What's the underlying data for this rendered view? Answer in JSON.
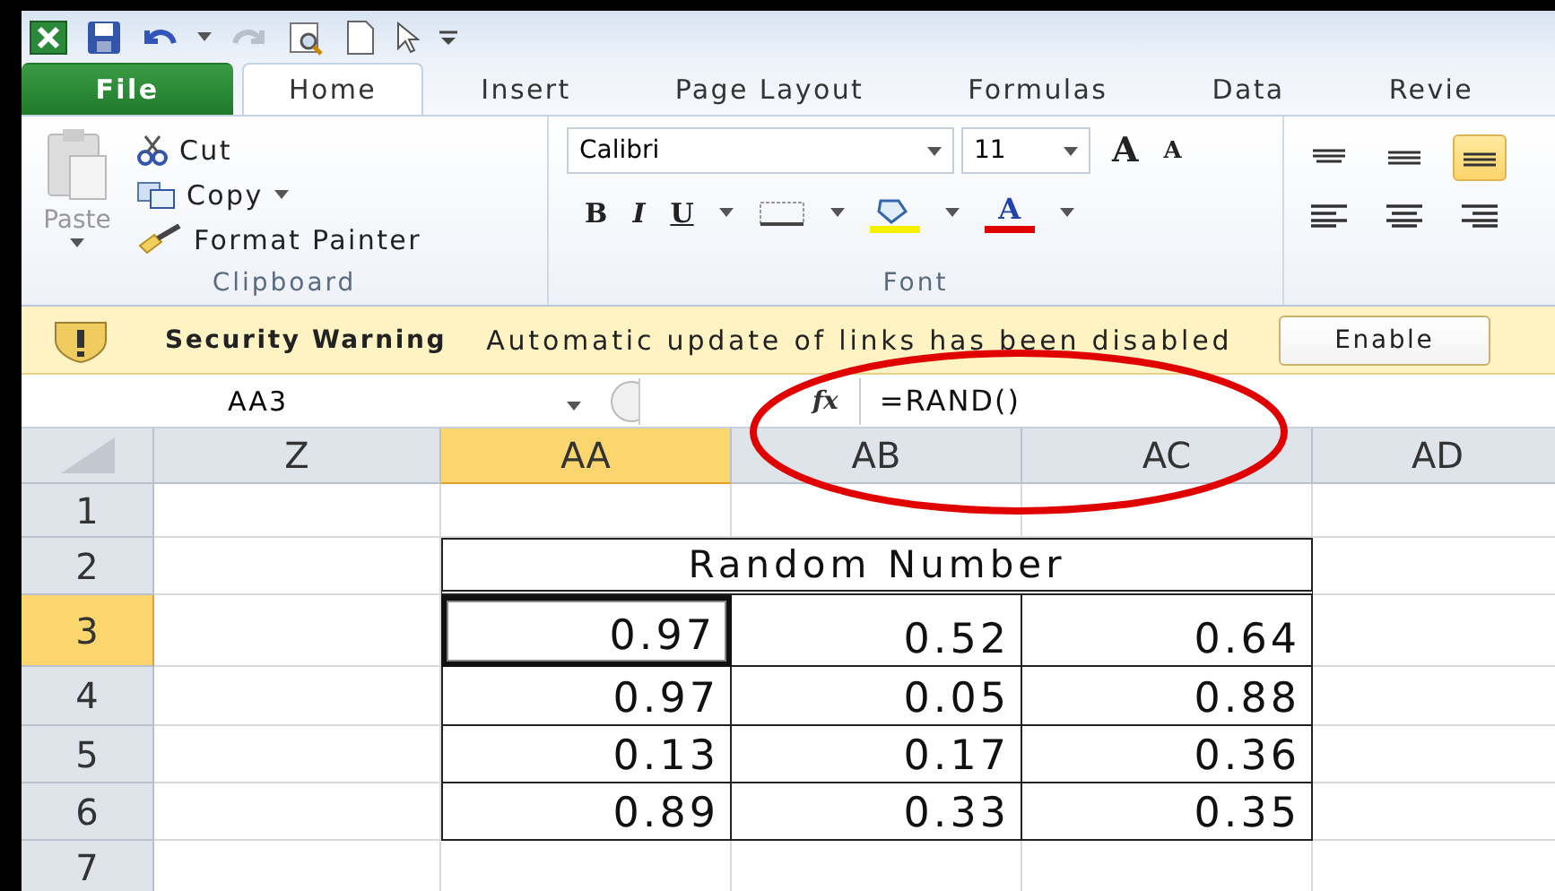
{
  "tabs": [
    {
      "label": "File",
      "kind": "file",
      "selected": false
    },
    {
      "label": "Home",
      "kind": "tab",
      "selected": true
    },
    {
      "label": "Insert",
      "kind": "tab",
      "selected": false
    },
    {
      "label": "Page Layout",
      "kind": "tab",
      "selected": false
    },
    {
      "label": "Formulas",
      "kind": "tab",
      "selected": false
    },
    {
      "label": "Data",
      "kind": "tab",
      "selected": false
    },
    {
      "label": "Revie",
      "kind": "tab",
      "selected": false
    }
  ],
  "clipboard": {
    "paste": "Paste",
    "cut": "Cut",
    "copy": "Copy",
    "format_painter": "Format Painter",
    "group_label": "Clipboard"
  },
  "font": {
    "font_name": "Calibri",
    "font_size": "11",
    "grow": "A",
    "shrink": "A",
    "bold": "B",
    "italic": "I",
    "underline": "U",
    "font_color": "A",
    "group_label": "Font"
  },
  "alignment": [
    {
      "selected": false
    },
    {
      "selected": false
    },
    {
      "selected": true
    }
  ],
  "security_bar": {
    "title": "Security Warning",
    "message": "Automatic update of links has been disabled",
    "button": "Enable"
  },
  "formula_bar": {
    "name_box": "AA3",
    "function_symbol": "fx",
    "formula": "=RAND()"
  },
  "columns": [
    {
      "label": "Z",
      "selected": false
    },
    {
      "label": "AA",
      "selected": true
    },
    {
      "label": "AB",
      "selected": false
    },
    {
      "label": "AC",
      "selected": false
    },
    {
      "label": "AD",
      "selected": false
    }
  ],
  "rows": [
    {
      "label": "1",
      "selected": false
    },
    {
      "label": "2",
      "selected": false,
      "title": "Random Number"
    },
    {
      "label": "3",
      "selected": true,
      "cells": [
        {
          "value": "0.97",
          "active": true
        },
        {
          "value": "0.52",
          "active": false
        },
        {
          "value": "0.64",
          "active": false
        }
      ]
    },
    {
      "label": "4",
      "selected": false,
      "cells": [
        {
          "value": "0.97",
          "active": false
        },
        {
          "value": "0.05",
          "active": false
        },
        {
          "value": "0.88",
          "active": false
        }
      ]
    },
    {
      "label": "5",
      "selected": false,
      "cells": [
        {
          "value": "0.13",
          "active": false
        },
        {
          "value": "0.17",
          "active": false
        },
        {
          "value": "0.36",
          "active": false
        }
      ]
    },
    {
      "label": "6",
      "selected": false,
      "cells": [
        {
          "value": "0.89",
          "active": false
        },
        {
          "value": "0.33",
          "active": false
        },
        {
          "value": "0.35",
          "active": false
        }
      ]
    },
    {
      "label": "7",
      "selected": false
    }
  ]
}
